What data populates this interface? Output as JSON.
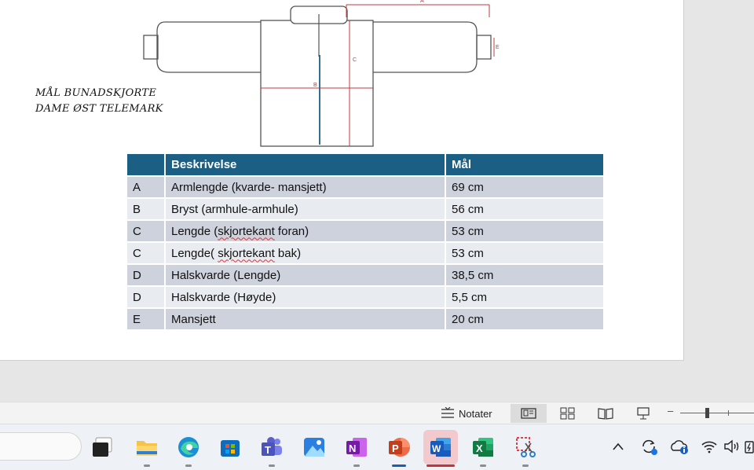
{
  "slide": {
    "title_lines": [
      "MÅL BUNADSKJORTE",
      "DAME ØST TELEMARK"
    ],
    "diagram_labels": {
      "a": "A",
      "b": "B",
      "c": "C",
      "e": "E"
    }
  },
  "table": {
    "headers": [
      "",
      "Beskrivelse",
      "Mål"
    ],
    "rows": [
      {
        "code": "A",
        "desc": "Armlengde (kvarde- mansjett)",
        "value": "69 cm"
      },
      {
        "code": "B",
        "desc": "Bryst (armhule-armhule)",
        "value": "56 cm"
      },
      {
        "code": "C",
        "desc_before": "Lengde (",
        "desc_squiggle": "skjortekant",
        "desc_after": " foran)",
        "value": "53 cm"
      },
      {
        "code": "C",
        "desc_before": "Lengde( ",
        "desc_squiggle": "skjortekant",
        "desc_after": " bak)",
        "value": "53 cm"
      },
      {
        "code": "D",
        "desc": "Halskvarde (Lengde)",
        "value": "38,5 cm"
      },
      {
        "code": "D",
        "desc": "Halskvarde (Høyde)",
        "value": "5,5 cm"
      },
      {
        "code": "E",
        "desc": "Mansjett",
        "value": "20 cm"
      }
    ]
  },
  "status_bar": {
    "notes_label": "Notater",
    "views": [
      "normal-view",
      "slide-sorter-view",
      "reading-view",
      "slideshow-view"
    ],
    "zoom_minus": "–"
  },
  "taskbar": {
    "apps": [
      {
        "name": "task-view",
        "icon": "task-view-icon"
      },
      {
        "name": "file-explorer",
        "icon": "folder-icon"
      },
      {
        "name": "edge",
        "icon": "edge-icon"
      },
      {
        "name": "microsoft-store",
        "icon": "store-icon"
      },
      {
        "name": "teams",
        "icon": "teams-icon",
        "letter": "T"
      },
      {
        "name": "photos",
        "icon": "photos-icon"
      },
      {
        "name": "onenote",
        "icon": "onenote-icon",
        "letter": "N"
      },
      {
        "name": "powerpoint",
        "icon": "powerpoint-icon",
        "letter": "P"
      },
      {
        "name": "word",
        "icon": "word-icon",
        "letter": "W"
      },
      {
        "name": "excel",
        "icon": "excel-icon",
        "letter": "X"
      },
      {
        "name": "snipping-tool",
        "icon": "scissors-icon"
      }
    ],
    "colors": {
      "word": "#185abd",
      "excel": "#107c41",
      "powerpoint": "#c43e1c",
      "onenote": "#7719aa",
      "teams": "#5b5fc7",
      "accent_active": "#c0363d"
    }
  }
}
